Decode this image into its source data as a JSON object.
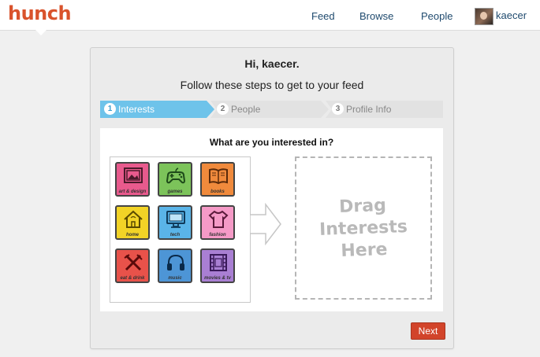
{
  "header": {
    "logo": "hunch",
    "nav": {
      "feed": "Feed",
      "browse": "Browse",
      "people": "People"
    },
    "username": "kaecer"
  },
  "onboarding": {
    "greeting": "Hi, kaecer.",
    "subtitle": "Follow these steps to get to your feed",
    "steps": [
      {
        "num": "1",
        "label": "Interests",
        "active": true
      },
      {
        "num": "2",
        "label": "People",
        "active": false
      },
      {
        "num": "3",
        "label": "Profile Info",
        "active": false
      }
    ],
    "question": "What are you interested in?",
    "interests": [
      {
        "label": "art & design",
        "color": "#e85a8d",
        "icon": "picture-icon"
      },
      {
        "label": "games",
        "color": "#7cc35a",
        "icon": "gamepad-icon"
      },
      {
        "label": "books",
        "color": "#f08a3c",
        "icon": "book-icon"
      },
      {
        "label": "home",
        "color": "#f2d326",
        "icon": "house-icon"
      },
      {
        "label": "tech",
        "color": "#5ab4e8",
        "icon": "monitor-icon"
      },
      {
        "label": "fashion",
        "color": "#f59ac7",
        "icon": "shirt-icon"
      },
      {
        "label": "eat & drink",
        "color": "#e8524a",
        "icon": "fork-knife-icon"
      },
      {
        "label": "music",
        "color": "#4d95d6",
        "icon": "headphones-icon"
      },
      {
        "label": "movies & tv",
        "color": "#a97fd3",
        "icon": "film-icon"
      }
    ],
    "dropzone_lines": [
      "Drag",
      "Interests",
      "Here"
    ],
    "next_label": "Next"
  }
}
